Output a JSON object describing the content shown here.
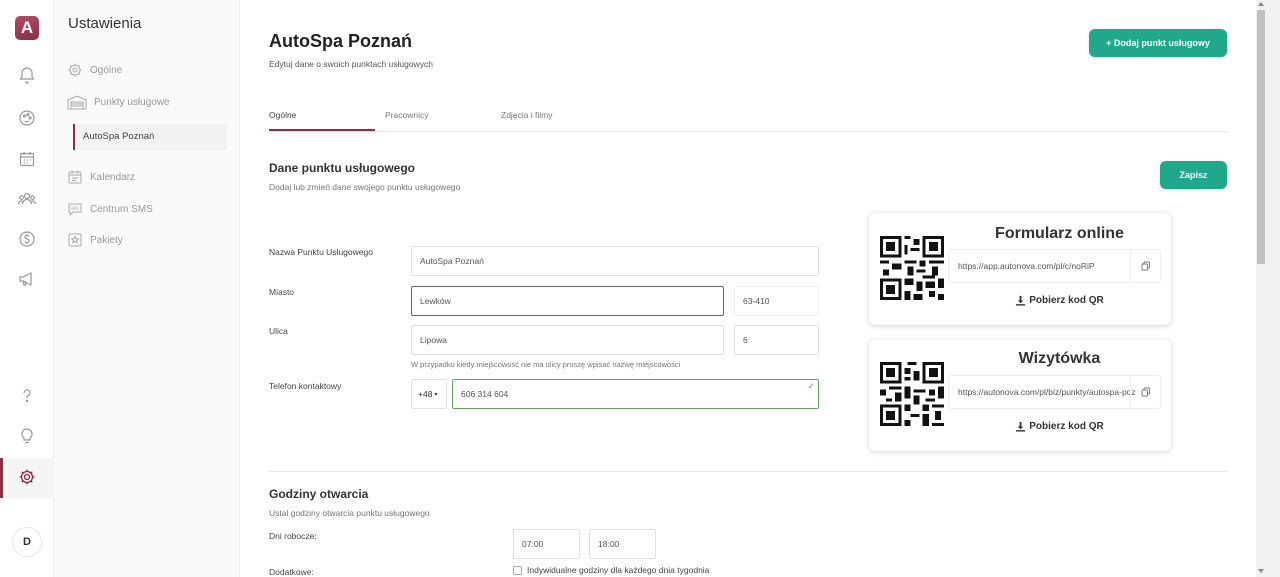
{
  "rail": {
    "logo_letter": "A",
    "icons": [
      "bell-icon",
      "palette-icon",
      "calendar-icon",
      "users-icon",
      "dollar-icon",
      "megaphone-icon",
      "help-icon",
      "lightbulb-icon",
      "gear-icon"
    ],
    "active": "gear-icon",
    "avatar_letter": "D"
  },
  "sidebar": {
    "title": "Ustawienia",
    "items": [
      {
        "label": "Ogólne",
        "icon": "gear-icon"
      },
      {
        "label": "Punkty usługowe",
        "icon": "garage-icon"
      },
      {
        "label": "Kalendarz",
        "icon": "calendar-icon"
      },
      {
        "label": "Centrum SMS",
        "icon": "sms-icon"
      },
      {
        "label": "Pakiety",
        "icon": "star-icon"
      }
    ],
    "sub_item": "AutoSpa Poznań"
  },
  "header": {
    "title": "AutoSpa Poznań",
    "subtitle": "Edytuj dane o swoich punktach usługowych",
    "add_button": "+ Dodaj punkt usługowy"
  },
  "tabs": [
    {
      "label": "Ogólne",
      "active": true
    },
    {
      "label": "Pracownicy",
      "active": false
    },
    {
      "label": "Zdjęcia i filmy",
      "active": false
    }
  ],
  "details": {
    "title": "Dane punktu usługowego",
    "subtitle": "Dodaj lub zmień dane swojego punktu usługowego",
    "save_button": "Zapisz",
    "name_label": "Nazwa Punktu Usługowego",
    "name_value": "AutoSpa Poznań",
    "city_label": "Miasto",
    "city_value": "Lewków",
    "postal_value": "63-410",
    "street_label": "Ulica",
    "street_value": "Lipowa",
    "number_value": "6",
    "street_hint": "W przypadku kiedy miejscowość nie ma ulicy proszę wpisać nazwę miejscowości",
    "phone_label": "Telefon kontaktowy",
    "phone_prefix": "+48",
    "phone_value": "606 314 604"
  },
  "cards": {
    "online_form": {
      "title": "Formularz online",
      "url": "https://app.autonova.com/pl/c/noRiP",
      "download": "Pobierz kod QR"
    },
    "business_card": {
      "title": "Wizytówka",
      "url": "https://autonova.com/pl/biz/punkty/autospa-poznan",
      "download": "Pobierz kod QR"
    }
  },
  "hours": {
    "title": "Godziny otwarcia",
    "subtitle": "Ustal godziny otwarcia punktu usługowego",
    "weekdays_label": "Dni robocze:",
    "open_value": "07:00",
    "close_value": "18:00",
    "extra_label": "Dodatkowe:",
    "individual_label": "Indywidualne godziny dla każdego dnia tygodnia"
  },
  "colors": {
    "accent": "#8c2d45",
    "primary_button": "#1fa88a",
    "valid": "#5ea85e"
  }
}
